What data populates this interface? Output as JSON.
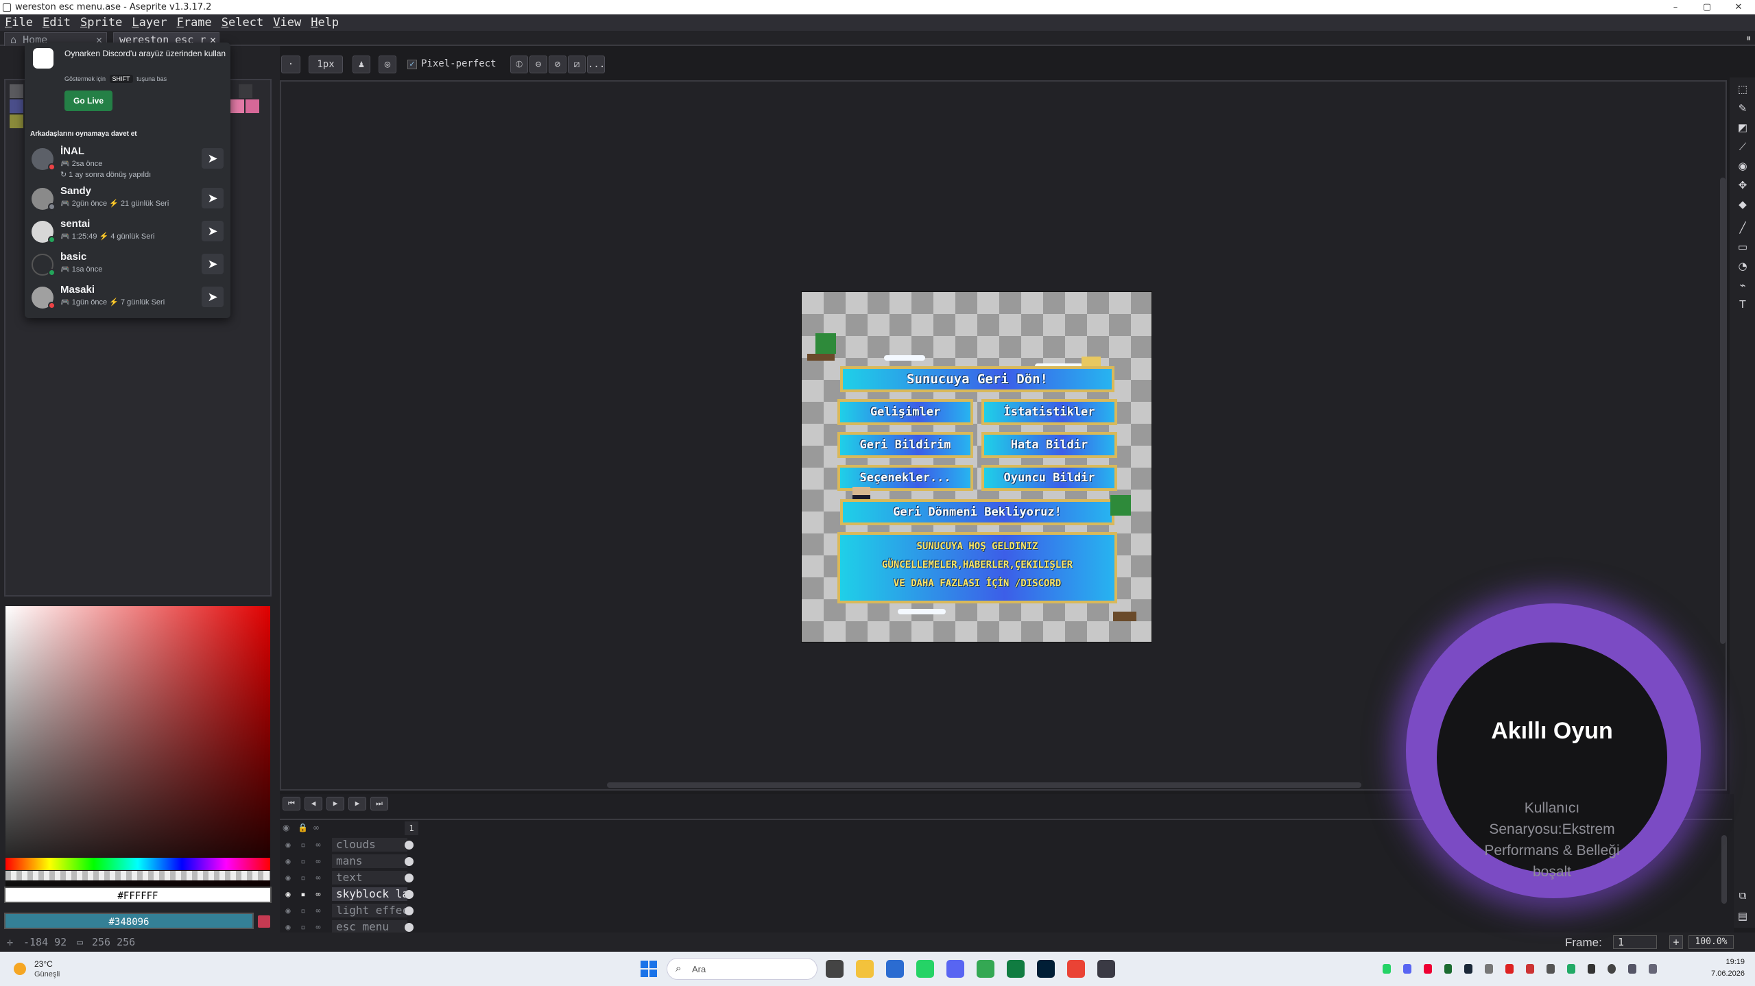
{
  "window": {
    "title": "wereston esc menu.ase - Aseprite v1.3.17.2",
    "minimize": "–",
    "maximize": "▢",
    "close": "✕"
  },
  "menu": [
    "File",
    "Edit",
    "Sprite",
    "Layer",
    "Frame",
    "Select",
    "View",
    "Help"
  ],
  "tabs": [
    {
      "label": "Home",
      "close": "✕"
    },
    {
      "label": "wereston_esc_r",
      "close": "✕"
    }
  ],
  "discord": {
    "headline": "Oynarken Discord'u arayüz üzerinden kullan",
    "hint_prefix": "Göstermek için",
    "hint_key": "SHIFT",
    "hint_suffix": "tuşuna bas",
    "go_live": "Go Live",
    "invite_heading": "Arkadaşlarını oynamaya davet et",
    "friends": [
      {
        "name": "İNAL",
        "meta": "🎮 2sa önce",
        "meta2": "↻ 1 ay sonra dönüş yapıldı",
        "status_color": "#ed4245"
      },
      {
        "name": "Sandy",
        "meta": "🎮 2gün önce  ⚡ 21 günlük Seri",
        "meta2": "",
        "status_color": "#80848e"
      },
      {
        "name": "sentai",
        "meta": "🎮 1:25:49  ⚡ 4 günlük Seri",
        "meta2": "",
        "status_color": "#23a55a"
      },
      {
        "name": "basic",
        "meta": "🎮 1sa önce",
        "meta2": "",
        "status_color": "#23a55a"
      },
      {
        "name": "Masaki",
        "meta": "🎮 1gün önce  ⚡ 7 günlük Seri",
        "meta2": "",
        "status_color": "#ed4245"
      }
    ],
    "invite_icon": "➤"
  },
  "toolbar": {
    "brush_size": "1px",
    "pixel_perfect": "Pixel-perfect",
    "more": "..."
  },
  "colors": {
    "foreground_hex": "#FFFFFF",
    "background_hex": "#348096"
  },
  "sprite_menu": {
    "title_button": "Sunucuya Geri Dön!",
    "buttons": [
      "Gelişimler",
      "İstatistikler",
      "Geri Bildirim",
      "Hata Bildir",
      "Seçenekler...",
      "Oyuncu Bildir"
    ],
    "wide_button": "Geri Dönmeni Bekliyoruz!",
    "banner_lines": [
      "SUNUCUYA HOŞ GELDINIZ",
      "GÜNCELLEMELER,HABERLER,ÇEKILIŞLER",
      "VE DAHA FAZLASI İÇİN /DISCORD"
    ]
  },
  "timeline": {
    "frame_header": "1",
    "layers": [
      "clouds",
      "mans",
      "text",
      "skyblock lar",
      "light effect",
      "esc menu"
    ],
    "active_layer": "skyblock lar"
  },
  "status": {
    "cursor_pos": "-184 92",
    "sprite_size": "256 256",
    "frame_label": "Frame:",
    "frame_value": "1",
    "zoom": "100.0%"
  },
  "overlay": {
    "title": "Akıllı Oyun",
    "subtitle": "Kullanıcı Senaryosu:Ekstrem Performans & Belleği boşalt"
  },
  "taskbar": {
    "weather_temp": "23°C",
    "weather_desc": "Güneşli",
    "search_placeholder": "Ara",
    "time": "19:19",
    "date": "7.06.2026"
  }
}
